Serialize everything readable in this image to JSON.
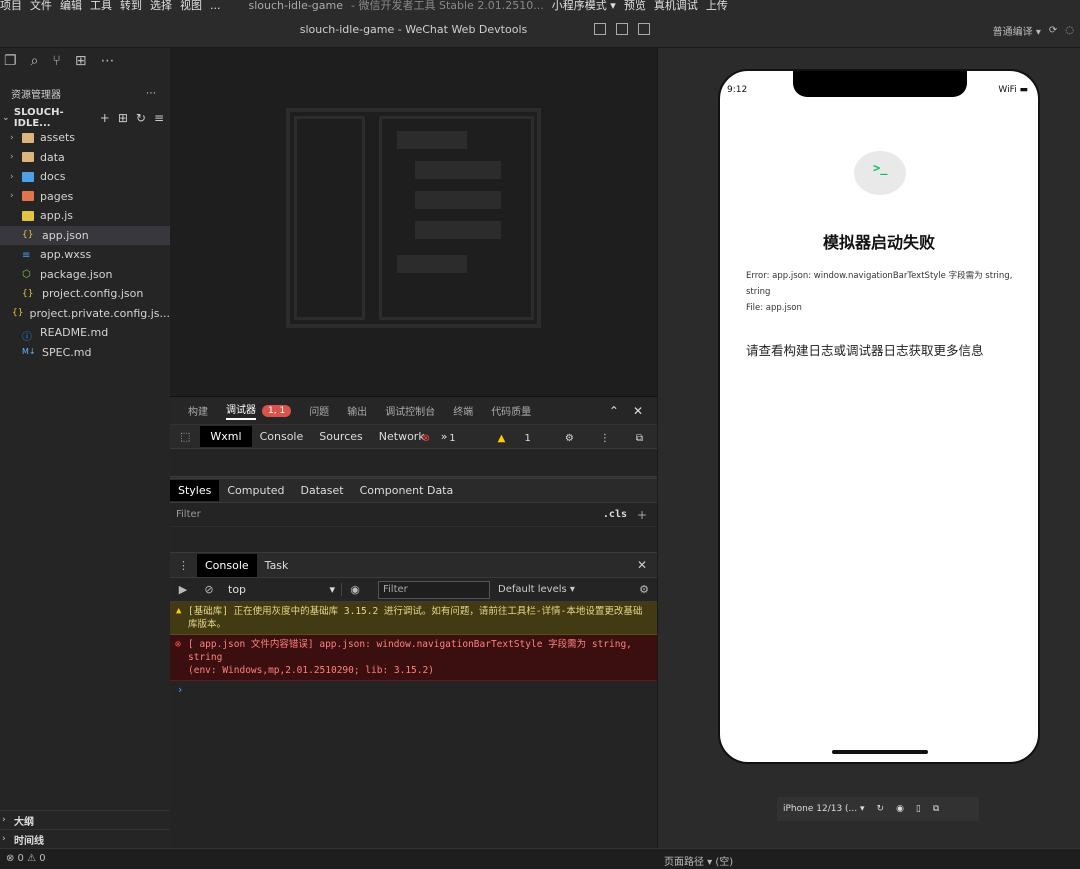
{
  "menubar": {
    "items": [
      "项目",
      "文件",
      "编辑",
      "工具",
      "转到",
      "选择",
      "视图",
      "..."
    ],
    "app_name": "slouch-idle-game",
    "build": "- 微信开发者工具 Stable 2.01.2510...",
    "mode": "小程序模式 ▾",
    "preview": "预览",
    "real_debug": "真机调试",
    "upload": "上传"
  },
  "titlebar": {
    "title": "slouch-idle-game - WeChat Web Devtools",
    "compile_mode": "普通编译 ▾"
  },
  "explorer": {
    "header": "资源管理器",
    "project": "SLOUCH-IDLE...",
    "items": [
      {
        "label": "assets"
      },
      {
        "label": "data"
      },
      {
        "label": "docs"
      },
      {
        "label": "pages"
      },
      {
        "label": "app.js"
      },
      {
        "label": "app.json"
      },
      {
        "label": "app.wxss"
      },
      {
        "label": "package.json"
      },
      {
        "label": "project.config.json"
      },
      {
        "label": "project.private.config.js..."
      },
      {
        "label": "README.md"
      },
      {
        "label": "SPEC.md"
      }
    ],
    "outline": "大纲",
    "timeline": "时间线"
  },
  "devtools": {
    "tabs": [
      "构建",
      "调试器",
      "问题",
      "输出",
      "调试控制台",
      "终端",
      "代码质量"
    ],
    "badge": "1, 1",
    "subtabs": [
      "Wxml",
      "Console",
      "Sources",
      "Network"
    ],
    "more": "»",
    "error_count": "1",
    "warn_count": "1",
    "style_tabs": [
      "Styles",
      "Computed",
      "Dataset",
      "Component Data"
    ],
    "filter_placeholder": "Filter",
    "cls": ".cls",
    "console_tabs": [
      "Console",
      "Task"
    ],
    "context": "top",
    "console_filter": "Filter",
    "levels": "Default levels ▾",
    "warn_msg": "[基础库] 正在使用灰度中的基础库 3.15.2 进行调试。如有问题，请前往工具栏-详情-本地设置更改基础库版本。",
    "err_msg_1": "[ app.json 文件内容错误] app.json: window.navigationBarTextStyle 字段需为 string, string",
    "err_msg_2": "(env: Windows,mp,2.01.2510290; lib: 3.15.2)",
    "prompt": "›"
  },
  "simulator": {
    "time": "9:12",
    "status_icons": "WiFi ▬",
    "bubble": ">_",
    "title": "模拟器启动失败",
    "error_line1": "Error: app.json: window.navigationBarTextStyle 字段需为 string, string",
    "error_line2": "File: app.json",
    "hint": "请查看构建日志或调试器日志获取更多信息",
    "device": "iPhone 12/13 (... ▾"
  },
  "statusbar": {
    "problems": "⊗ 0 ⚠ 0",
    "page_path": "页面路径 ▾",
    "page_path_extra": "(空)"
  }
}
